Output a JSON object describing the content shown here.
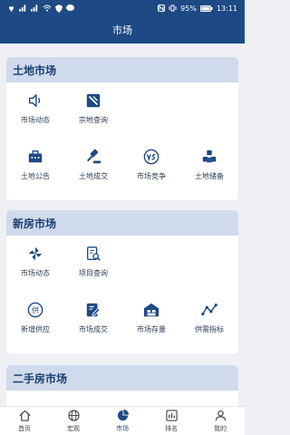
{
  "status": {
    "left_icons": [
      "huawei-icon",
      "signal-icon",
      "signal-icon",
      "wifi-icon",
      "shield-icon",
      "chat-icon"
    ],
    "battery": "95%",
    "time": "13:11"
  },
  "header": {
    "title": "市场"
  },
  "sections": [
    {
      "title": "土地市场",
      "items": [
        {
          "label": "市场动态",
          "icon": "speaker-icon"
        },
        {
          "label": "宗地查询",
          "icon": "land-parcel-icon"
        },
        {
          "label": "土地公告",
          "icon": "bulletin-icon"
        },
        {
          "label": "土地成交",
          "icon": "gavel-icon"
        },
        {
          "label": "市场竞争",
          "icon": "versus-icon"
        },
        {
          "label": "土地储备",
          "icon": "cubes-icon"
        }
      ]
    },
    {
      "title": "新房市场",
      "items": [
        {
          "label": "市场动态",
          "icon": "pinwheel-icon"
        },
        {
          "label": "项目查询",
          "icon": "document-search-icon"
        },
        {
          "label": "新增供应",
          "icon": "supply-badge-icon"
        },
        {
          "label": "市场成交",
          "icon": "edit-document-icon"
        },
        {
          "label": "市场存量",
          "icon": "warehouse-icon"
        },
        {
          "label": "供需指标",
          "icon": "trend-line-icon"
        }
      ]
    },
    {
      "title": "二手房市场",
      "items": []
    }
  ],
  "badges": {
    "supply": "供"
  },
  "tabs": [
    {
      "label": "首页",
      "icon": "home-icon",
      "active": false
    },
    {
      "label": "宏观",
      "icon": "globe-icon",
      "active": false
    },
    {
      "label": "市场",
      "icon": "pie-chart-icon",
      "active": true
    },
    {
      "label": "排名",
      "icon": "bar-chart-icon",
      "active": false
    },
    {
      "label": "我的",
      "icon": "user-icon",
      "active": false
    }
  ],
  "colors": {
    "primary": "#1d4a85",
    "section_head": "#cfdaec",
    "background": "#eef0f4"
  }
}
